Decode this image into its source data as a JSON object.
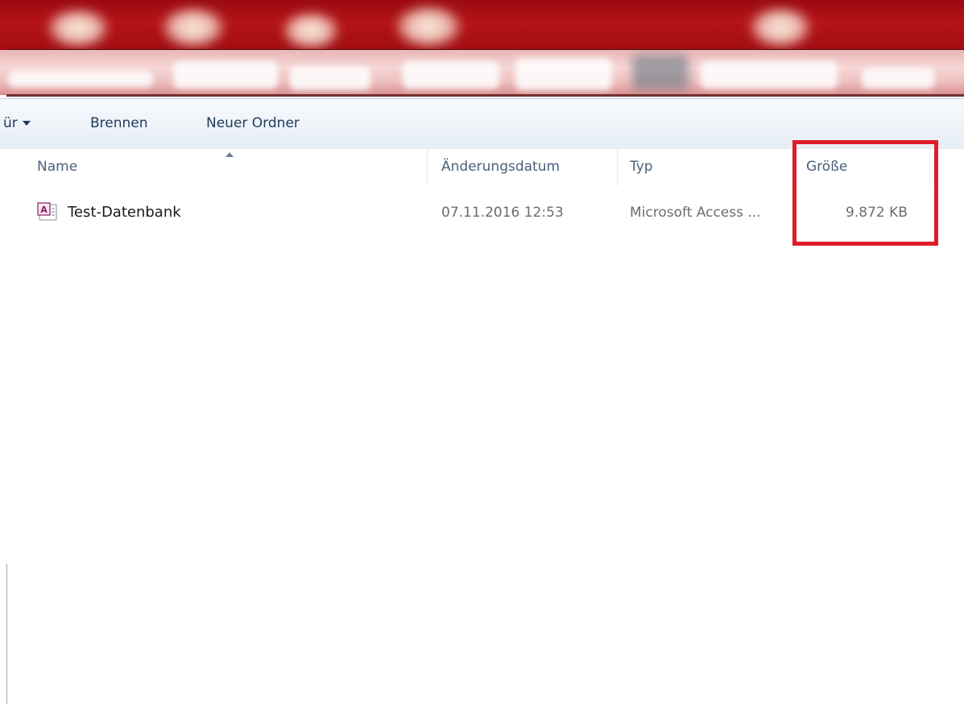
{
  "toolbar": {
    "organize_label": "ür",
    "burn_label": "Brennen",
    "new_folder_label": "Neuer Ordner"
  },
  "columns": {
    "name": "Name",
    "modified": "Änderungsdatum",
    "type": "Typ",
    "size": "Größe"
  },
  "files": [
    {
      "name": "Test-Datenbank",
      "modified": "07.11.2016 12:53",
      "type": "Microsoft Access ...",
      "size": "9.872 KB",
      "icon": "access-database-icon"
    }
  ],
  "colors": {
    "titlebar": "#a10d12",
    "toolbar_text": "#1e395b",
    "highlight": "#e01b2a"
  }
}
